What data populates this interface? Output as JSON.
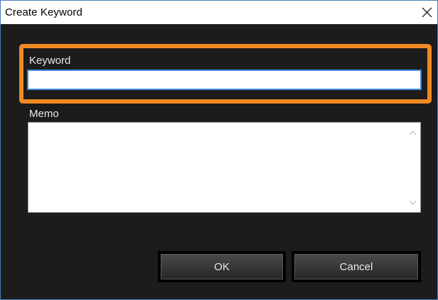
{
  "window": {
    "title": "Create Keyword",
    "close_icon": "close-icon"
  },
  "form": {
    "keyword_label": "Keyword",
    "keyword_value": "",
    "memo_label": "Memo",
    "memo_value": ""
  },
  "buttons": {
    "ok_label": "OK",
    "cancel_label": "Cancel"
  },
  "colors": {
    "highlight": "#f08a24",
    "background": "#1c1c1c",
    "input_focus_border": "#3d88d6"
  }
}
